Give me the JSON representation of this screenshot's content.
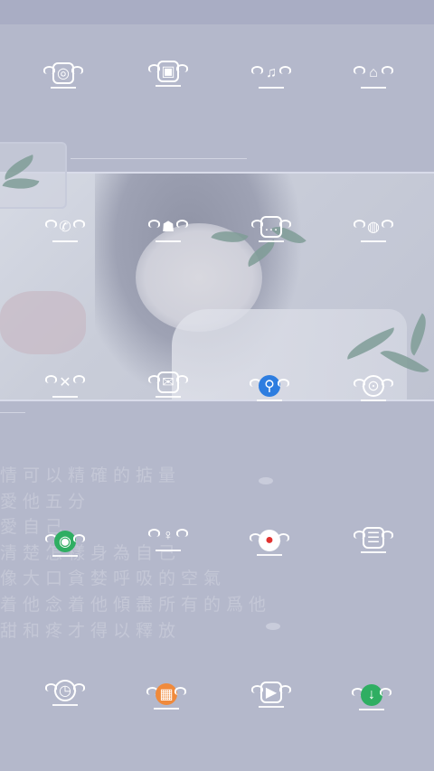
{
  "lyrics": [
    "情可以精確的掂量",
    "愛他五分",
    "愛自己",
    "清楚怎樣身為自己",
    "像大口貪婪呼吸的空氣",
    "着他念着他傾盡所有的爲他",
    "甜和疼才得以釋放"
  ],
  "colors": {
    "background": "#b4b8cb",
    "green": "#2fae62",
    "orange": "#f08a3c",
    "red": "#e2322f",
    "blue": "#2d7de0"
  },
  "icons": [
    {
      "name": "camera-icon",
      "glyph": "◎"
    },
    {
      "name": "gallery-icon",
      "glyph": "▣"
    },
    {
      "name": "music-icon",
      "glyph": "♫"
    },
    {
      "name": "shop-bag-icon",
      "glyph": "⌂"
    },
    {
      "name": "phone-icon",
      "glyph": "✆"
    },
    {
      "name": "contacts-icon",
      "glyph": "☗"
    },
    {
      "name": "messages-icon",
      "glyph": "…"
    },
    {
      "name": "browser-icon",
      "glyph": "◍"
    },
    {
      "name": "settings-tools-icon",
      "glyph": "✕"
    },
    {
      "name": "mail-icon",
      "glyph": "✉"
    },
    {
      "name": "search-icon",
      "glyph": "⚲"
    },
    {
      "name": "compass-icon",
      "glyph": "⊙"
    },
    {
      "name": "wifi-hotspot-icon",
      "glyph": "◉"
    },
    {
      "name": "lollipop-icon",
      "glyph": "♀"
    },
    {
      "name": "record-icon",
      "glyph": "●"
    },
    {
      "name": "notes-icon",
      "glyph": "☰"
    },
    {
      "name": "clock-icon",
      "glyph": "◷"
    },
    {
      "name": "calendar-grid-icon",
      "glyph": "▦"
    },
    {
      "name": "video-icon",
      "glyph": "▶"
    },
    {
      "name": "download-icon",
      "glyph": "↓"
    }
  ]
}
